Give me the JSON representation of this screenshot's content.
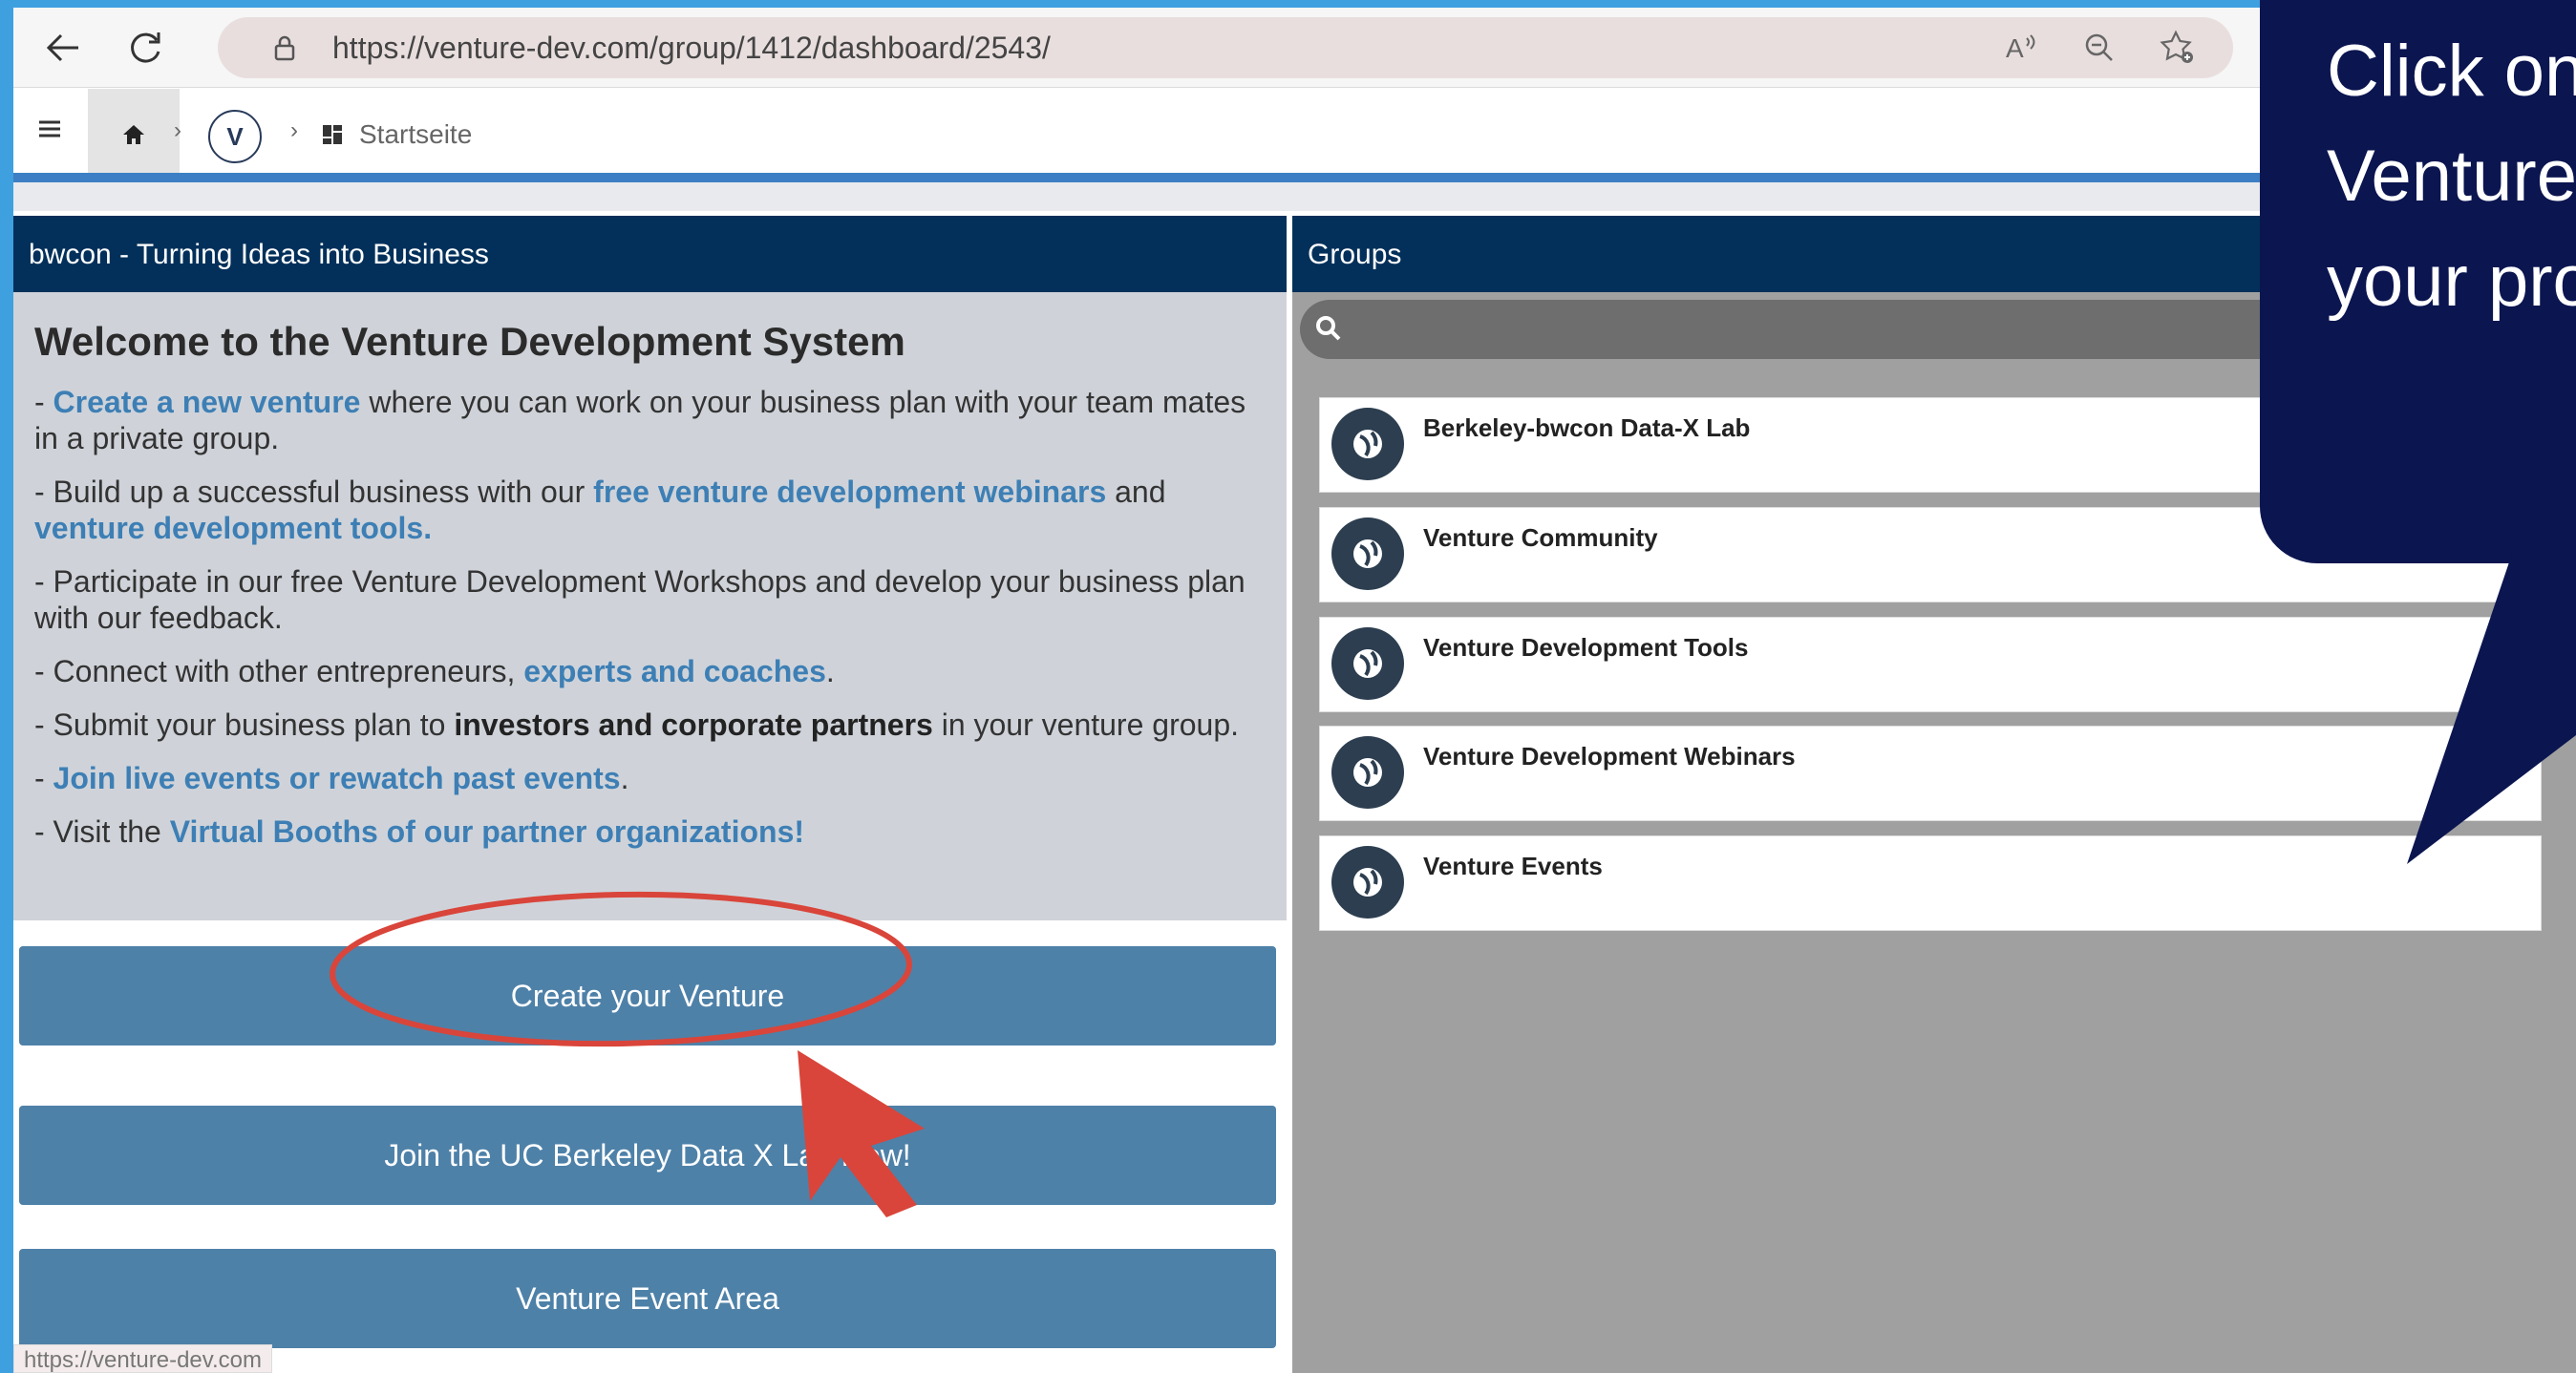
{
  "browser": {
    "url": "https://venture-dev.com/group/1412/dashboard/2543/",
    "status_url": "https://venture-dev.com",
    "icons": [
      "back-icon",
      "refresh-icon",
      "lock-icon",
      "read-aloud-icon",
      "zoom-icon",
      "add-favorite-icon"
    ]
  },
  "app_nav": {
    "avatar_letter": "V",
    "breadcrumb_label": "Startseite"
  },
  "left_panel": {
    "header": "bwcon - Turning Ideas into Business",
    "title": "Welcome to the Venture Development System",
    "lines": {
      "l1_prefix": "- ",
      "l1_link": "Create a new venture",
      "l1_rest": " where you can work on your business plan with your team mates in a private group.",
      "l2_prefix": "- Build up a successful business with our ",
      "l2_link1": "free venture development webinars",
      "l2_mid": " and ",
      "l2_link2": "venture development tools.",
      "l3": "- Participate in our free Venture Development Workshops and develop your business plan with our feedback.",
      "l4_prefix": "- Connect with other entrepreneurs, ",
      "l4_link": "experts and coaches",
      "l4_suffix": ".",
      "l5_prefix": "- Submit your business plan to ",
      "l5_bold": "investors and corporate partners",
      "l5_suffix": " in your venture group.",
      "l6_prefix": "- ",
      "l6_link": "Join live events or rewatch past events",
      "l6_suffix": ".",
      "l7_prefix": "- Visit the ",
      "l7_link": "Virtual Booths of our partner organizations!"
    },
    "buttons": {
      "create": "Create your Venture",
      "join": "Join the UC Berkeley Data X Lab Now!",
      "event": "Venture Event Area"
    }
  },
  "right_panel": {
    "header": "Groups",
    "groups": [
      "Berkeley-bwcon Data-X Lab",
      "Venture Community",
      "Venture Development Tools",
      "Venture Development Webinars",
      "Venture Events"
    ]
  },
  "callout": {
    "line1": "Click on",
    "line2": "Venture",
    "line3": "your pro"
  },
  "colors": {
    "header_navy": "#03305a",
    "button_blue": "#4e81a8",
    "callout_navy": "#0b1550",
    "annotation_red": "#d9453a"
  }
}
